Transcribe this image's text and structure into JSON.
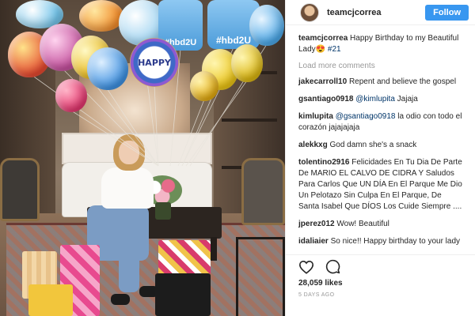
{
  "post": {
    "username": "teamcjcorrea",
    "follow_label": "Follow",
    "caption": {
      "user": "teamcjcorrea",
      "text": "Happy Birthday to my Beautiful Lady😍",
      "hashtag": "#21"
    },
    "load_more_label": "Load more comments",
    "comments": [
      {
        "user": "jakecarroll10",
        "mention": "",
        "text": "Repent and believe the gospel"
      },
      {
        "user": "gsantiago0918",
        "mention": "@kimlupita",
        "text": "Jajaja"
      },
      {
        "user": "kimlupita",
        "mention": "@gsantiago0918",
        "text": "la odio con todo el corazón jajajajaja"
      },
      {
        "user": "alekkxg",
        "mention": "",
        "text": "God damn she's a snack"
      },
      {
        "user": "tolentino2916",
        "mention": "",
        "text": "Felicidades En Tu Dia De Parte De MARIO EL CALVO DE CIDRA Y Saludos Para Carlos Que UN DÍA En El Parque Me Dio Un Pelotazo Sin Culpa En El Parque, De Santa Isabel Que DÍOS Los Cuide Siempre ...."
      },
      {
        "user": "jperez012",
        "mention": "",
        "text": "Wow! Beautiful"
      },
      {
        "user": "idaliaier",
        "mention": "",
        "text": "So nice!! Happy birthday to your lady"
      }
    ],
    "likes": "28,059 likes",
    "time_ago": "5 DAYS AGO"
  },
  "photo": {
    "balloon_text_1": "#hbd2U",
    "balloon_text_2": "#hbd2U",
    "round_balloon_text": "HAPPY"
  },
  "colors": {
    "follow_blue": "#3897f0",
    "mention_blue": "#003569"
  }
}
